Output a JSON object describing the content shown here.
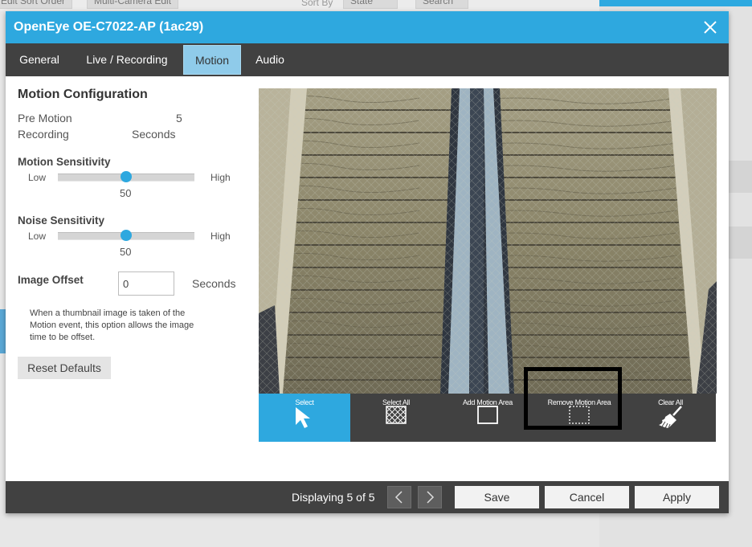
{
  "background": {
    "sort_label": "Edit Sort Order",
    "multi_camera_edit": "Multi-Camera Edit",
    "sort_by": "Sort By",
    "state_select": "State",
    "search_label": "Search"
  },
  "dialog": {
    "title": "OpenEye OE-C7022-AP (1ac29)",
    "tabs": [
      {
        "label": "General",
        "active": false
      },
      {
        "label": "Live / Recording",
        "active": false
      },
      {
        "label": "Motion",
        "active": true
      },
      {
        "label": "Audio",
        "active": false
      }
    ]
  },
  "motion_config": {
    "heading": "Motion Configuration",
    "pre_motion_label_1": "Pre Motion",
    "pre_motion_label_2": "Recording",
    "pre_motion_value": "5",
    "pre_motion_unit": "Seconds",
    "motion_sensitivity": {
      "label": "Motion Sensitivity",
      "low": "Low",
      "high": "High",
      "value": "50",
      "level": 0.5
    },
    "noise_sensitivity": {
      "label": "Noise Sensitivity",
      "low": "Low",
      "high": "High",
      "value": "50",
      "level": 0.5
    },
    "image_offset": {
      "label": "Image Offset",
      "value": "0",
      "unit": "Seconds"
    },
    "note_lines": [
      "When a thumbnail image is taken of the",
      "Motion event, this option allows the image",
      "time to be offset."
    ],
    "reset_label": "Reset Defaults"
  },
  "tools": [
    {
      "label": "Select",
      "icon": "cursor-arrow-icon",
      "active": true
    },
    {
      "label": "Select All",
      "icon": "crosshatch-grid-icon",
      "active": false
    },
    {
      "label": "Add Motion Area",
      "icon": "square-outline-icon",
      "active": false
    },
    {
      "label": "Remove Motion Area",
      "icon": "dashed-square-icon",
      "active": false
    },
    {
      "label": "Clear All",
      "icon": "broom-icon",
      "active": false
    }
  ],
  "footer": {
    "displaying": "Displaying 5 of 5",
    "save": "Save",
    "cancel": "Cancel",
    "apply": "Apply"
  },
  "colors": {
    "accent": "#2ea8df",
    "dark_bar": "#414141"
  }
}
